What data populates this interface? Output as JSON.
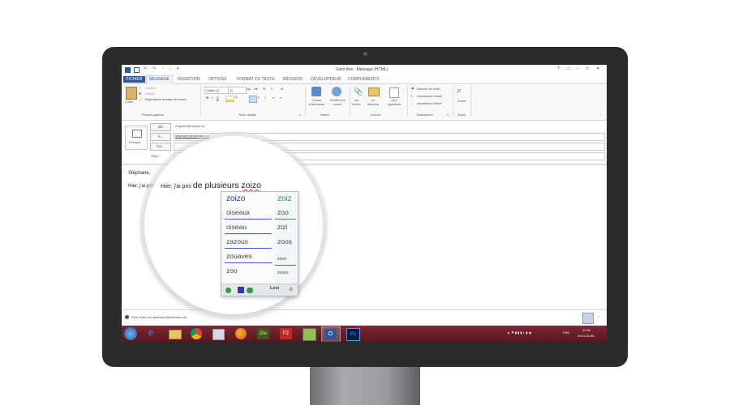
{
  "window": {
    "title": "Sans titre - Message (HTML)",
    "help": "?"
  },
  "ribbon": {
    "tabs": [
      "FICHIER",
      "MESSAGE",
      "INSERTION",
      "OPTIONS",
      "FORMAT DU TEXTE",
      "RÉVISION",
      "DÉVELOPPEUR",
      "COMPLÉMENTS"
    ],
    "clipboard": {
      "paste": "Coller",
      "cut": "Couper",
      "copy": "Copier",
      "painter": "Reproduire la mise en forme",
      "group": "Presse-papiers"
    },
    "basic_text": {
      "font": "Calibri (C",
      "size": "11",
      "group": "Texte simple"
    },
    "names": {
      "address_book": "Carnet d'adresses",
      "check_names": "Vérifier les noms",
      "group": "Noms"
    },
    "include": {
      "file": "Un fichier",
      "element": "Un élément",
      "signature": "Une signature",
      "group": "Inclure"
    },
    "tags": {
      "follow_up": "Assurer un suivi",
      "high": "Importance haute",
      "low": "Importance faible",
      "group": "Indicateurs"
    },
    "zoom": {
      "label": "Zoom",
      "group": "Zoom"
    }
  },
  "compose": {
    "send": "Envoyer",
    "from_label": "De",
    "from_value": "rhaynes@hayleis.ca",
    "to_label": "À...",
    "to_value": "stephane@hotmail.com",
    "cc_label": "Cc...",
    "subject_label": "Objet"
  },
  "body": {
    "greeting": "Stéphane,",
    "line_prefix": "Hier, j'ai pris ",
    "line_big": "de plusieurs",
    "typed_word": "zoizo"
  },
  "suggestions": {
    "col1": [
      "zoizo",
      "oiseaux",
      "oiseau",
      "zazous",
      "zouaves",
      "zoo"
    ],
    "col2": [
      "zoiz",
      "zoo",
      "zizi",
      "zoos",
      "zoné",
      "zones"
    ],
    "footer_label": "Lexi"
  },
  "info_bar": {
    "text": "Plus d'info sur stephane@hotmail.com."
  },
  "taskbar": {
    "lang": "FRA",
    "time": "11:06",
    "date": "2014-02-06",
    "dw_label": "Dw",
    "ps_label": "Ps",
    "fz_label": "FZ",
    "ol_label": "O"
  },
  "colors": {
    "accent": "#2b579a",
    "typed_underline": "#d23b3b",
    "suggest_first": "#1a3fc7",
    "suggest_second": "#2e9b3c",
    "taskbar": "#6d1f2a"
  }
}
